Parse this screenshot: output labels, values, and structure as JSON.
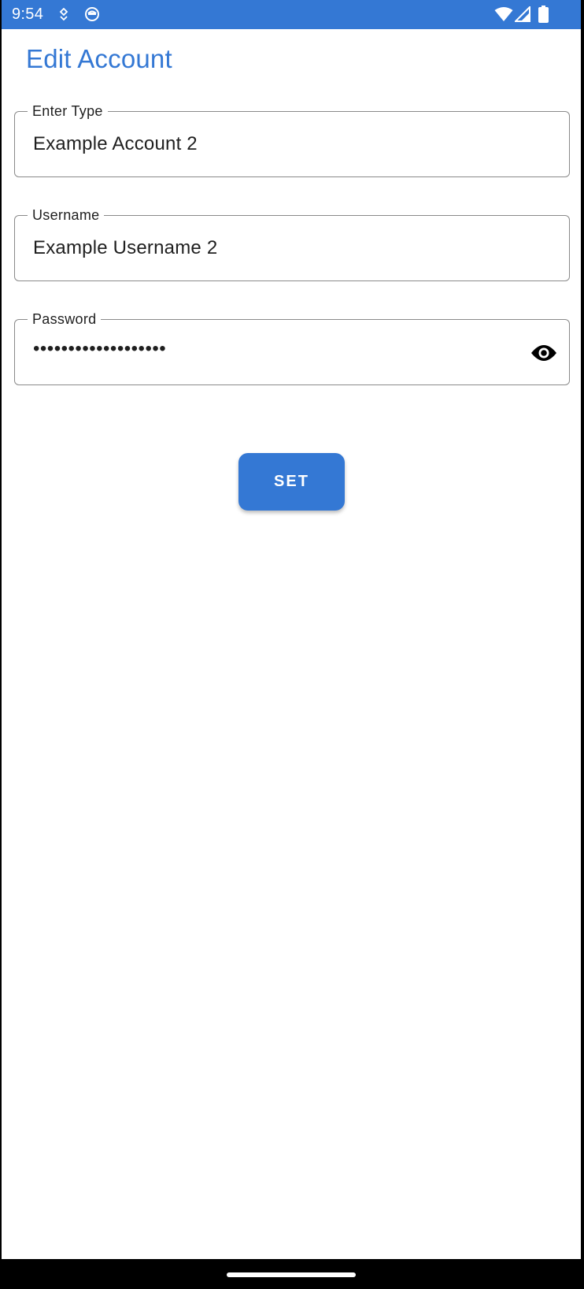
{
  "status_bar": {
    "time": "9:54",
    "icons": [
      "location-icon",
      "app-notification-icon",
      "wifi-icon",
      "cell-signal-icon",
      "battery-icon"
    ],
    "background_color": "#3478d4"
  },
  "header": {
    "title": "Edit Account",
    "title_color": "#3478d4"
  },
  "form": {
    "type_field": {
      "label": "Enter Type",
      "value": "Example Account 2"
    },
    "username_field": {
      "label": "Username",
      "value": "Example Username 2"
    },
    "password_field": {
      "label": "Password",
      "masked_value": "•••••••••••••••••••",
      "toggle_icon": "eye-icon"
    },
    "submit_label": "SET",
    "accent_color": "#3478d4"
  },
  "navigation": {
    "handle": "home-handle"
  }
}
